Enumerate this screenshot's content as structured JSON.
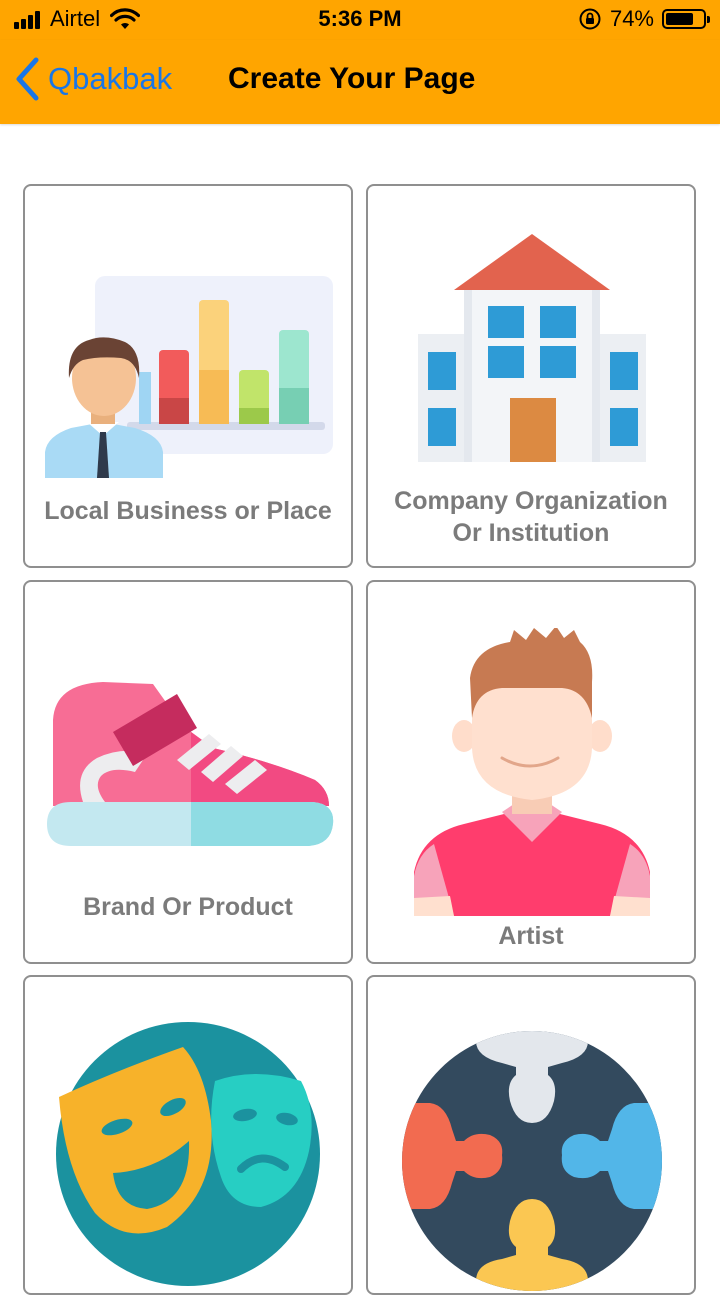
{
  "status_bar": {
    "carrier": "Airtel",
    "time": "5:36 PM",
    "battery_percent": "74%",
    "battery_level": 0.74
  },
  "nav": {
    "back_label": "Qbakbak",
    "title": "Create Your Page"
  },
  "categories": [
    {
      "label_line1": "Local Business or Place",
      "label_line2": "",
      "icon": "business-presentation-icon"
    },
    {
      "label_line1": "Company Organization",
      "label_line2": "Or Institution",
      "icon": "building-icon"
    },
    {
      "label_line1": "Brand Or Product",
      "label_line2": "",
      "icon": "sneaker-icon"
    },
    {
      "label_line1": "Artist",
      "label_line2": "",
      "icon": "artist-person-icon"
    },
    {
      "label_line1": "",
      "label_line2": "",
      "icon": "theater-masks-icon"
    },
    {
      "label_line1": "",
      "label_line2": "",
      "icon": "community-people-icon"
    }
  ],
  "colors": {
    "header": "#FFA500",
    "back_link": "#1976E8",
    "card_border": "#8F8F8F",
    "label_text": "#7B7B7B"
  }
}
